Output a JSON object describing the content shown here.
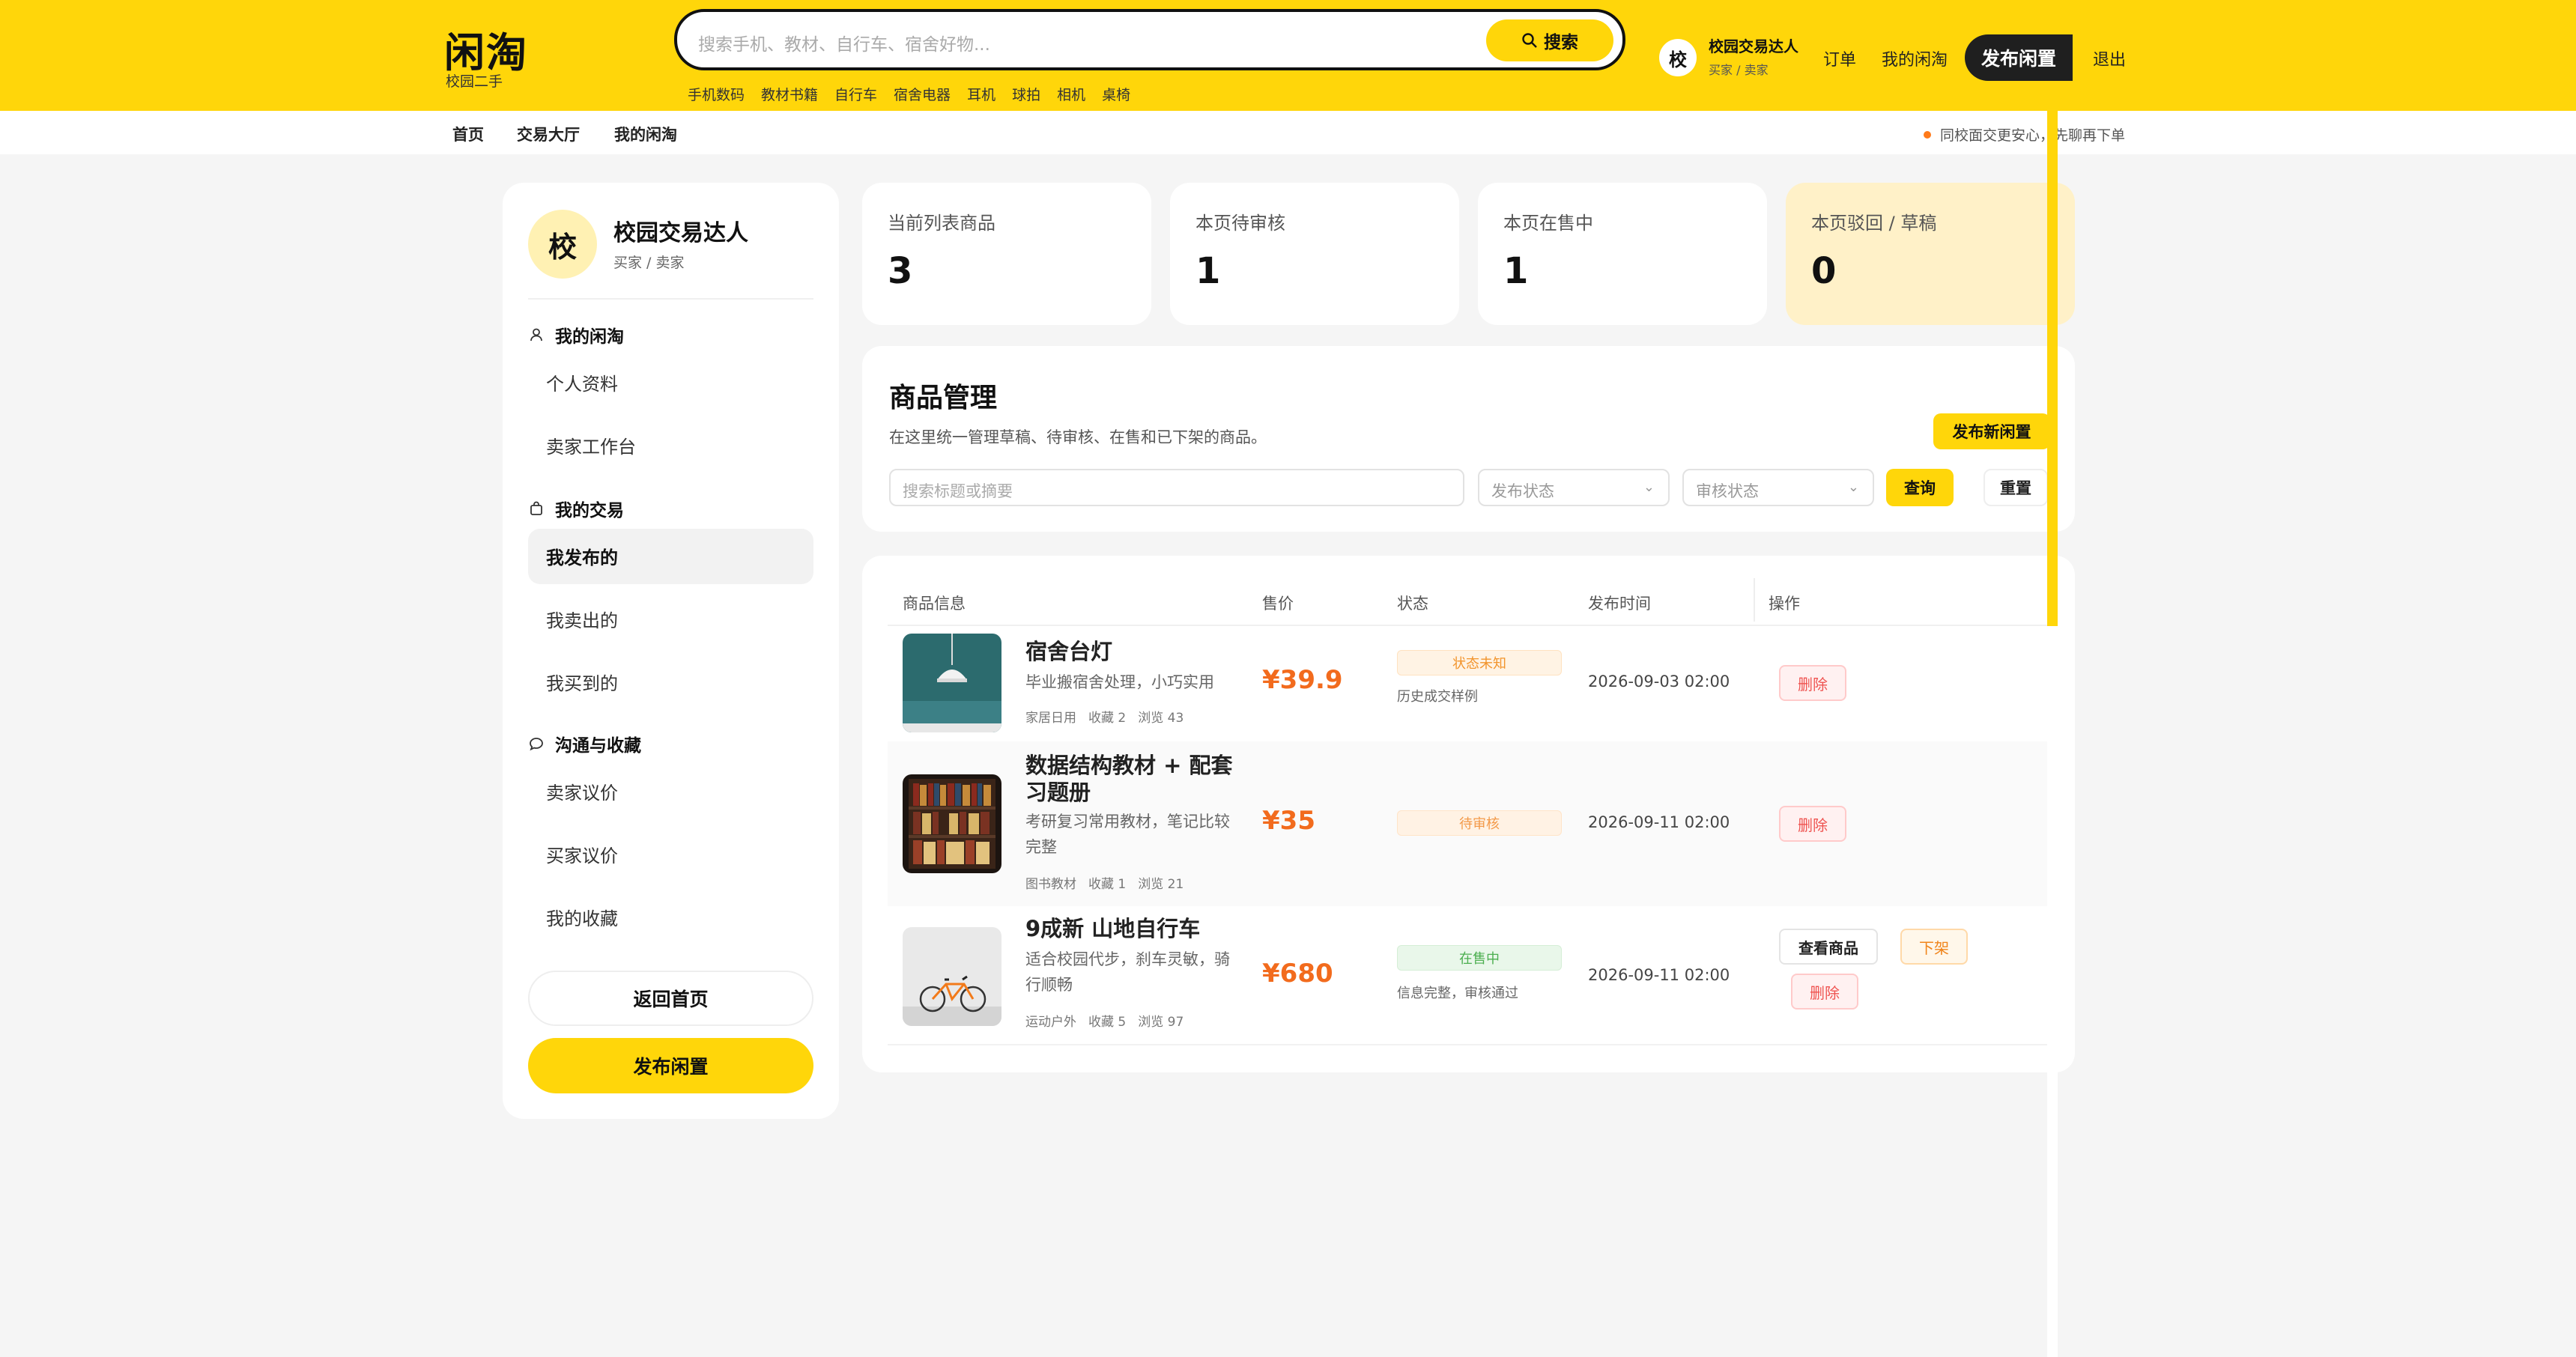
{
  "header": {
    "logo": "闲淘",
    "logo_sub": "校园二手",
    "search_placeholder": "搜索手机、教材、自行车、宿舍好物...",
    "search_button": "搜索",
    "hot_words": [
      "手机数码",
      "教材书籍",
      "自行车",
      "宿舍电器",
      "耳机",
      "球拍",
      "相机",
      "桌椅"
    ],
    "avatar_char": "校",
    "user_name": "校园交易达人",
    "user_role": "买家 / 卖家",
    "orders": "订单",
    "my_xiantao": "我的闲淘",
    "publish": "发布闲置",
    "logout": "退出"
  },
  "subnav": {
    "home": "首页",
    "market": "交易大厅",
    "my": "我的闲淘",
    "notice": "同校面交更安心，先聊再下单"
  },
  "sidebar": {
    "avatar_char": "校",
    "name": "校园交易达人",
    "role": "买家 / 卖家",
    "groups": [
      {
        "label": "我的闲淘",
        "icon": "user-icon",
        "items": [
          "个人资料",
          "卖家工作台"
        ]
      },
      {
        "label": "我的交易",
        "icon": "bag-icon",
        "items": [
          "我发布的",
          "我卖出的",
          "我买到的"
        ]
      },
      {
        "label": "沟通与收藏",
        "icon": "chat-icon",
        "items": [
          "卖家议价",
          "买家议价",
          "我的收藏"
        ]
      }
    ],
    "back_home": "返回首页",
    "publish": "发布闲置"
  },
  "stats": [
    {
      "label": "当前列表商品",
      "value": "3"
    },
    {
      "label": "本页待审核",
      "value": "1"
    },
    {
      "label": "本页在售中",
      "value": "1"
    },
    {
      "label": "本页驳回 / 草稿",
      "value": "0"
    }
  ],
  "filter": {
    "title": "商品管理",
    "desc": "在这里统一管理草稿、待审核、在售和已下架的商品。",
    "new_button": "发布新闲置",
    "search_placeholder": "搜索标题或摘要",
    "publish_status": "发布状态",
    "audit_status": "审核状态",
    "query": "查询",
    "reset": "重置"
  },
  "table": {
    "headers": [
      "商品信息",
      "售价",
      "状态",
      "发布时间",
      "操作"
    ],
    "rows": [
      {
        "title": "宿舍台灯",
        "desc": "毕业搬宿舍处理，小巧实用",
        "category": "家居日用",
        "fav": "收藏 2",
        "views": "浏览 43",
        "price": "¥39.9",
        "status": "状态未知",
        "note": "历史成交样例",
        "time": "2026-09-03 02:00",
        "actions": [
          "删除"
        ]
      },
      {
        "title": "数据结构教材 + 配套习题册",
        "desc": "考研复习常用教材，笔记比较完整",
        "category": "图书教材",
        "fav": "收藏 1",
        "views": "浏览 21",
        "price": "¥35",
        "status": "待审核",
        "note": "",
        "time": "2026-09-11 02:00",
        "actions": [
          "删除"
        ]
      },
      {
        "title": "9成新 山地自行车",
        "desc": "适合校园代步，刹车灵敏，骑行顺畅",
        "category": "运动户外",
        "fav": "收藏 5",
        "views": "浏览 97",
        "price": "¥680",
        "status": "在售中",
        "note": "信息完整，审核通过",
        "time": "2026-09-11 02:00",
        "actions": [
          "查看商品",
          "下架",
          "删除"
        ]
      }
    ]
  },
  "colors": {
    "brand": "#ffd60a",
    "price": "#f26b1d",
    "danger": "#ef5350",
    "success": "#4caf50"
  }
}
